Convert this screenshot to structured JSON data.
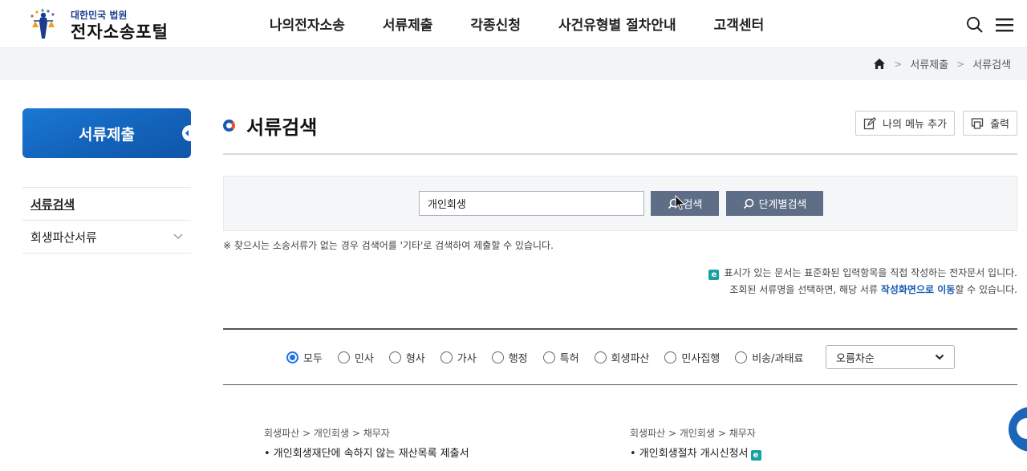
{
  "header": {
    "logo_sub": "대한민국 법원",
    "logo_main": "전자소송포털",
    "nav": [
      "나의전자소송",
      "서류제출",
      "각종신청",
      "사건유형별 절차안내",
      "고객센터"
    ]
  },
  "breadcrumb": [
    "서류제출",
    "서류검색"
  ],
  "sidebar": {
    "title": "서류제출",
    "items": [
      {
        "label": "서류검색"
      },
      {
        "label": "회생파산서류"
      }
    ]
  },
  "page": {
    "title": "서류검색",
    "my_menu_label": "나의 메뉴 추가",
    "print_label": "출력"
  },
  "search": {
    "value": "개인회생",
    "search_label": "검색",
    "step_search_label": "단계별검색"
  },
  "notice": "※ 찾으시는 소송서류가 없는 경우 검색어를 '기타'로 검색하여 제출할 수 있습니다.",
  "info": {
    "badge": "e",
    "line1": "표시가 있는 문서는 표준화된 입력항목을 직접 작성하는 전자문서 입니다.",
    "line2_pre": "조회된 서류명을 선택하면, 해당 서류 ",
    "line2_hl": "작성화면으로 이동",
    "line2_post": "할 수 있습니다."
  },
  "filters": {
    "options": [
      "모두",
      "민사",
      "형사",
      "가사",
      "행정",
      "특허",
      "회생파산",
      "민사집행",
      "비송/과태료"
    ],
    "selected": "모두",
    "sort": "오름차순"
  },
  "results": [
    {
      "path": "회생파산 > 개인회생 > 채무자",
      "doc": "• 개인회생재단에 속하지 않는 재산목록 제출서",
      "electronic": false
    },
    {
      "path": "회생파산 > 개인회생 > 채무자",
      "doc": "• 개인회생절차 개시신청서",
      "electronic": true
    }
  ]
}
